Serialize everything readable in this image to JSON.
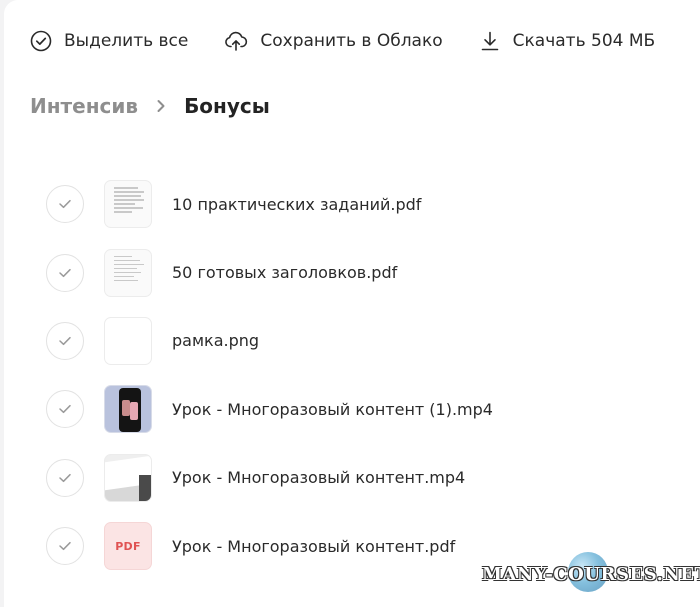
{
  "toolbar": {
    "select_all": "Выделить все",
    "save_to_cloud": "Сохранить в Облако",
    "download": "Скачать 504 МБ"
  },
  "breadcrumb": {
    "parent": "Интенсив",
    "current": "Бонусы"
  },
  "files": [
    {
      "name": "10 практических заданий.pdf",
      "thumbnail": "document-preview"
    },
    {
      "name": "50 готовых заголовков.pdf",
      "thumbnail": "document-preview"
    },
    {
      "name": "рамка.png",
      "thumbnail": "blank-image"
    },
    {
      "name": "Урок - Многоразовый контент (1).mp4",
      "thumbnail": "video-preview"
    },
    {
      "name": "Урок - Многоразовый контент.mp4",
      "thumbnail": "video-preview"
    },
    {
      "name": "Урок - Многоразовый контент.pdf",
      "thumbnail": "pdf-badge",
      "badge": "PDF"
    }
  ],
  "watermark": "MANY-COURSES.NET",
  "colors": {
    "background": "#ffffff",
    "muted_text": "#8e8e8e",
    "pdf_badge_bg": "#fbe4e4",
    "pdf_badge_text": "#e05252"
  }
}
